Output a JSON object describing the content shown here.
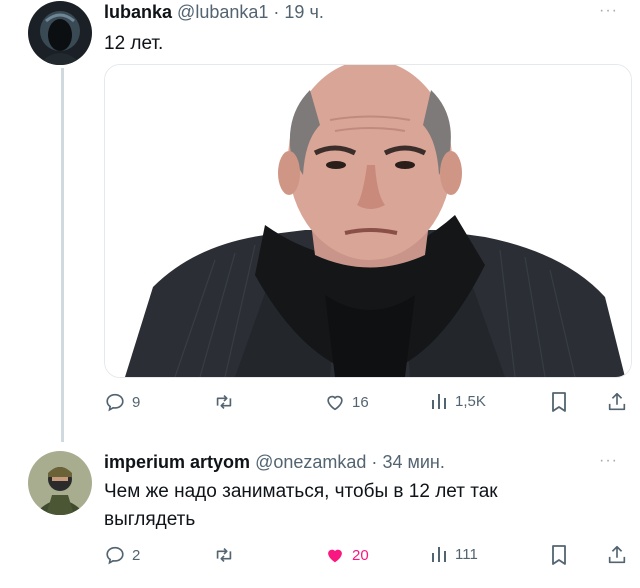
{
  "tweet1": {
    "display_name": "lubanka",
    "handle": "@lubanka1",
    "separator": "·",
    "time": "19 ч.",
    "text": "12 лет.",
    "more_icon": "more-dots-icon",
    "media_description": "photo",
    "actions": {
      "replies": "9",
      "retweets": "",
      "likes": "16",
      "views": "1,5K"
    }
  },
  "tweet2": {
    "display_name": "imperium artyom",
    "handle": "@onezamkad",
    "separator": "·",
    "time": "34 мин.",
    "text": "Чем же надо заниматься, чтобы в 12 лет так выглядеть",
    "more_icon": "more-dots-icon",
    "actions": {
      "replies": "2",
      "retweets": "",
      "likes": "20",
      "views": "111"
    }
  },
  "colors": {
    "like_active": "#f91880",
    "muted": "#536471",
    "thread_line": "#cfd9de"
  }
}
